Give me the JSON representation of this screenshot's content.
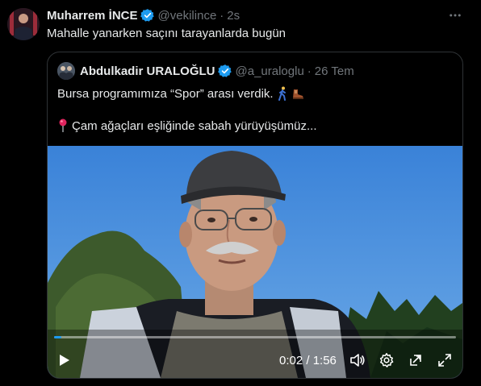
{
  "tweet": {
    "author_name": "Muharrem İNCE",
    "handle": "@vekilince",
    "separator": "·",
    "time": "2s",
    "text": "Mahalle yanarken saçını tarayanlarda bugün"
  },
  "quote": {
    "author_name": "Abdulkadir URALOĞLU",
    "handle": "@a_uraloglu",
    "separator": "·",
    "time": "26 Tem",
    "line1": "Bursa programımıza “Spor” arası verdik.",
    "line2": "Çam ağaçları eşliğinde sabah yürüyüşümüz..."
  },
  "video": {
    "timecode": "0:02 / 1:56",
    "progress_fraction": 0.018
  },
  "icons": {
    "verified": "verified-badge-icon",
    "more": "more-horizontal-icon",
    "walking": "person-walking-emoji",
    "shoe": "hiking-boot-emoji",
    "pin": "round-pushpin-emoji",
    "play": "play-icon",
    "volume": "volume-icon",
    "settings": "gear-icon",
    "pip": "picture-in-picture-icon",
    "fullscreen": "fullscreen-icon"
  },
  "colors": {
    "background": "#000000",
    "text_primary": "#e7e9ea",
    "text_secondary": "#71767b",
    "verified_blue": "#1d9bf0",
    "border": "#2f3336",
    "sky": "#3f86d6"
  }
}
